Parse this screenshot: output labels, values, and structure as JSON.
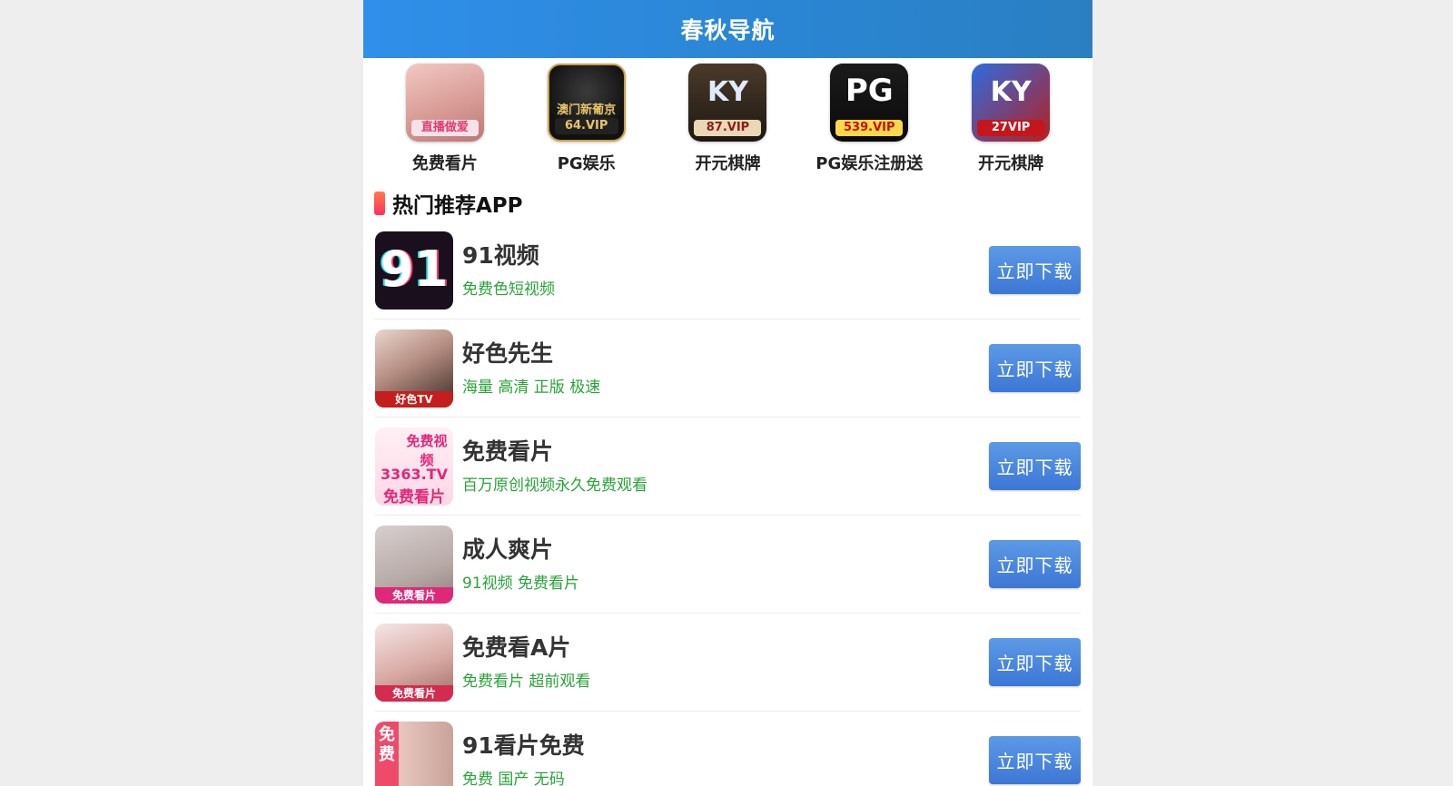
{
  "header": {
    "title": "春秋导航"
  },
  "quick_links": [
    {
      "label": "免费看片",
      "icon": "video-thumbnail-icon",
      "badge": "直播做爱"
    },
    {
      "label": "PG娱乐",
      "icon": "casino-logo-icon",
      "badge": "64.VIP",
      "mark": "澳门新葡京"
    },
    {
      "label": "开元棋牌",
      "icon": "ky-cards-icon",
      "badge": "87.VIP",
      "mark": "KY"
    },
    {
      "label": "PG娱乐注册送",
      "icon": "pg-logo-icon",
      "badge": "539.VIP",
      "mark": "PG"
    },
    {
      "label": "开元棋牌",
      "icon": "ky-logo-icon",
      "badge": "27VIP",
      "mark": "KY"
    }
  ],
  "section": {
    "title": "热门推荐APP"
  },
  "apps": [
    {
      "name": "91视频",
      "desc": "免费色短视频",
      "button": "立即下载",
      "icon_text": "91"
    },
    {
      "name": "好色先生",
      "desc": "海量 高清 正版 极速",
      "button": "立即下载",
      "icon_text": "好色TV"
    },
    {
      "name": "免费看片",
      "desc": "百万原创视频永久免费观看",
      "button": "立即下载",
      "icon_text_1": "免费视频",
      "icon_text_2": "3363.TV",
      "icon_text_3": "免费看片"
    },
    {
      "name": "成人爽片",
      "desc": "91视频 免费看片",
      "button": "立即下载",
      "icon_text": "免费看片"
    },
    {
      "name": "免费看A片",
      "desc": "免费看片 超前观看",
      "button": "立即下载",
      "icon_text": "免费看片"
    },
    {
      "name": "91看片免费",
      "desc": "免费 国产 无码",
      "button": "立即下载",
      "icon_text": "免费"
    }
  ],
  "colors": {
    "header_bg": "#2f8fea",
    "button_bg": "#4a88de",
    "desc_text": "#29a339",
    "section_accent": "#ff3f5e"
  }
}
